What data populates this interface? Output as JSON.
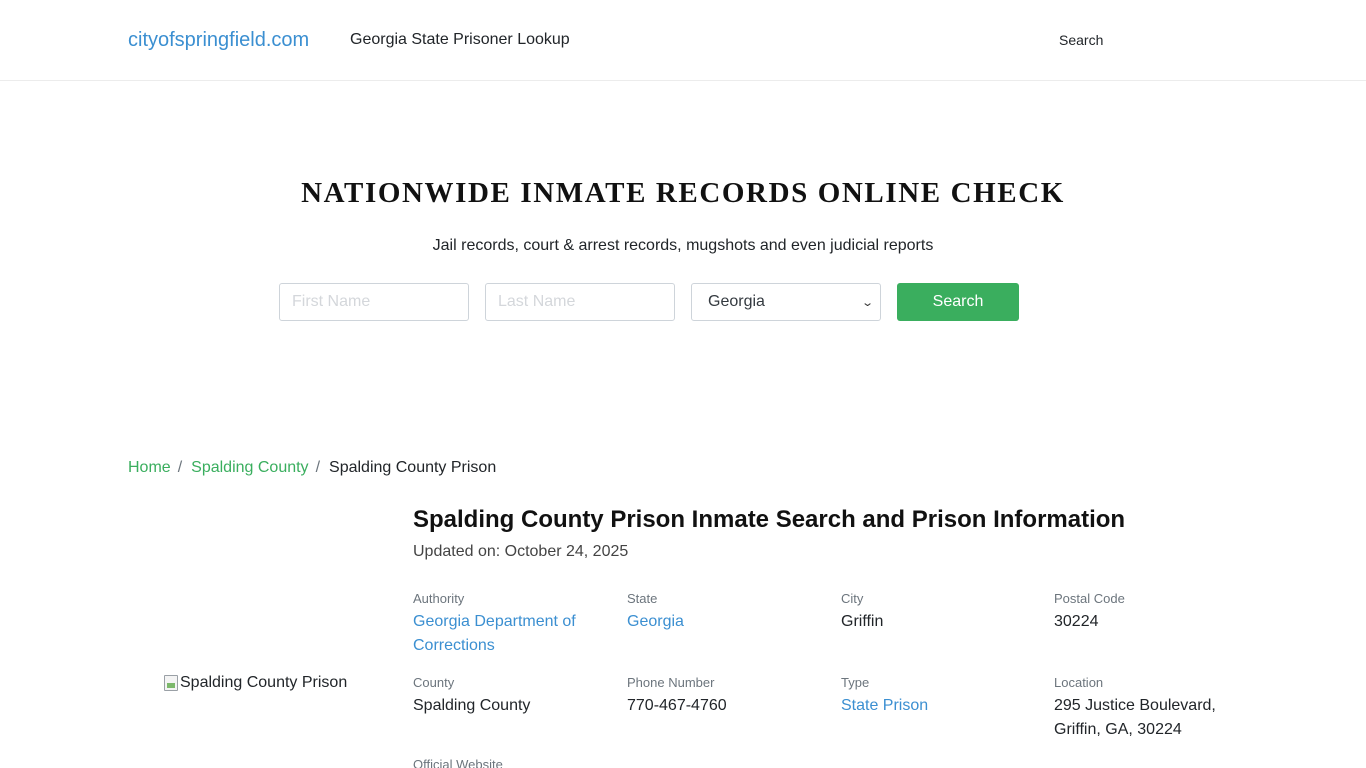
{
  "header": {
    "brand": "cityofspringfield.com",
    "title": "Georgia State Prisoner Lookup",
    "search_link": "Search"
  },
  "hero": {
    "title": "NATIONWIDE INMATE RECORDS ONLINE CHECK",
    "subtitle": "Jail records, court & arrest records, mugshots and even judicial reports",
    "first_name_placeholder": "First Name",
    "last_name_placeholder": "Last Name",
    "state_selected": "Georgia",
    "search_button": "Search"
  },
  "breadcrumb": {
    "home": "Home",
    "county": "Spalding County",
    "current": "Spalding County Prison",
    "separator": "/"
  },
  "image_alt": "Spalding County Prison",
  "main": {
    "title": "Spalding County Prison Inmate Search and Prison Information",
    "updated": "Updated on: October 24, 2025",
    "fields": {
      "authority_label": "Authority",
      "authority_value": "Georgia Department of Corrections",
      "state_label": "State",
      "state_value": "Georgia",
      "city_label": "City",
      "city_value": "Griffin",
      "postal_label": "Postal Code",
      "postal_value": "30224",
      "county_label": "County",
      "county_value": "Spalding County",
      "phone_label": "Phone Number",
      "phone_value": "770-467-4760",
      "type_label": "Type",
      "type_value": "State Prison",
      "location_label": "Location",
      "location_value": "295 Justice Boulevard, Griffin, GA, 30224",
      "website_label": "Official Website"
    }
  },
  "colors": {
    "brand_blue": "#3b8fd1",
    "accent_green": "#3aae5e"
  }
}
